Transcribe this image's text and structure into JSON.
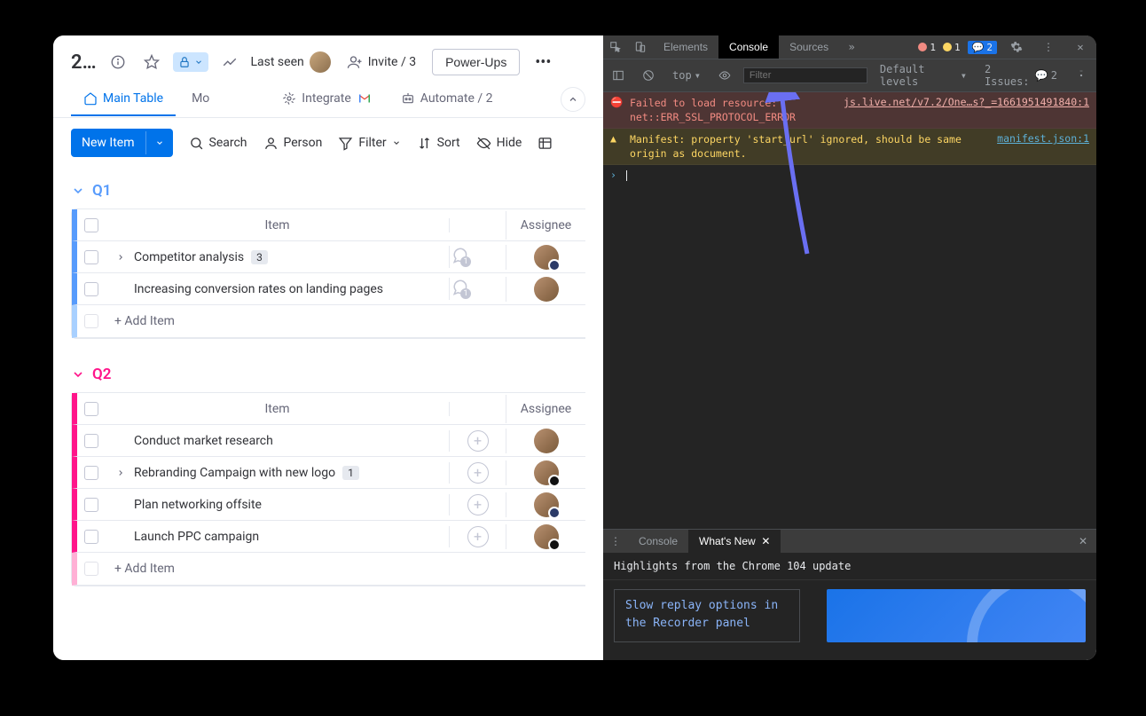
{
  "board": {
    "title": "2…",
    "last_seen": "Last seen",
    "invite": "Invite / 3",
    "powerups": "Power-Ups"
  },
  "tabs": {
    "main": "Main Table",
    "mo": "Mo",
    "integrate": "Integrate",
    "automate": "Automate / 2"
  },
  "toolbar": {
    "new_item": "New Item",
    "search": "Search",
    "person": "Person",
    "filter": "Filter",
    "sort": "Sort",
    "hide": "Hide"
  },
  "columns": {
    "item": "Item",
    "assignee": "Assignee"
  },
  "groups": [
    {
      "name": "Q1",
      "rows": [
        {
          "title": "Competitor analysis",
          "subitems": 3,
          "expandable": true,
          "convo": 1,
          "badge_color": "#2b3a67"
        },
        {
          "title": "Increasing conversion rates on landing pages",
          "subitems": 0,
          "expandable": false,
          "convo": 1,
          "badge_color": null
        }
      ]
    },
    {
      "name": "Q2",
      "rows": [
        {
          "title": "Conduct market research",
          "subitems": 0,
          "expandable": false,
          "convo": 0,
          "badge_color": null
        },
        {
          "title": "Rebranding Campaign with new logo",
          "subitems": 1,
          "expandable": true,
          "convo": 0,
          "badge_color": "#111"
        },
        {
          "title": "Plan networking offsite",
          "subitems": 0,
          "expandable": false,
          "convo": 0,
          "badge_color": "#2b3a67"
        },
        {
          "title": "Launch PPC campaign",
          "subitems": 0,
          "expandable": false,
          "convo": 0,
          "badge_color": "#111"
        }
      ]
    }
  ],
  "add_item": "+ Add Item",
  "devtools": {
    "tabs": {
      "elements": "Elements",
      "console": "Console",
      "sources": "Sources"
    },
    "badges": {
      "errors": "1",
      "warnings": "1",
      "info": "2",
      "issues_label": "2 Issues:",
      "issues_count": "2"
    },
    "console_bar": {
      "top": "top",
      "filter_placeholder": "Filter",
      "levels": "Default levels"
    },
    "messages": [
      {
        "type": "error",
        "text": "Failed to load resource: net::ERR_SSL_PROTOCOL_ERROR",
        "src": "js.live.net/v7.2/One…s?_=1661951491840:1"
      },
      {
        "type": "warn",
        "text": "Manifest: property 'start_url' ignored, should be same origin as document.",
        "src": "manifest.json:1"
      }
    ],
    "drawer": {
      "console": "Console",
      "whatsnew": "What's New",
      "headline": "Highlights from the Chrome 104 update",
      "card_title": "Slow replay options in the Recorder panel"
    }
  }
}
